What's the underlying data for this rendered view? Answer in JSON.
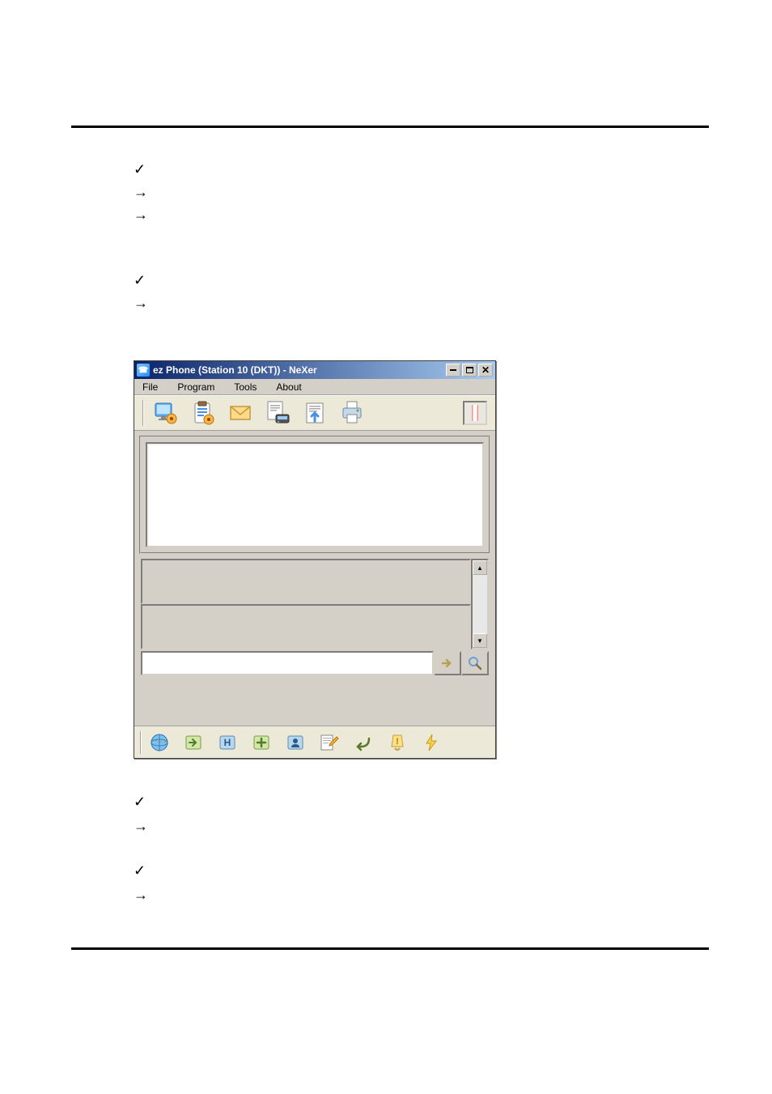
{
  "bullets": {
    "top": [
      "✓",
      "→",
      "→"
    ],
    "mid": [
      "✓",
      "→"
    ],
    "bottom1": [
      "✓",
      "→"
    ],
    "bottom2": [
      "✓",
      "→"
    ]
  },
  "window": {
    "title": "ez Phone (Station 10 (DKT)) - NeXer",
    "menus": [
      "File",
      "Program",
      "Tools",
      "About"
    ],
    "toolbar": [
      {
        "name": "monitor-settings-icon"
      },
      {
        "name": "clipboard-settings-icon"
      },
      {
        "name": "mail-icon"
      },
      {
        "name": "document-device-icon"
      },
      {
        "name": "document-up-icon"
      },
      {
        "name": "printer-icon"
      }
    ],
    "record_label": "",
    "go_label": "",
    "search_label": "",
    "bottom_icons": [
      {
        "name": "globe-icon"
      },
      {
        "name": "forward-box-icon"
      },
      {
        "name": "hold-icon"
      },
      {
        "name": "plus-box-icon"
      },
      {
        "name": "user-box-icon"
      },
      {
        "name": "edit-paper-icon"
      },
      {
        "name": "reply-arrow-icon"
      },
      {
        "name": "bell-alert-icon"
      },
      {
        "name": "lightning-icon"
      }
    ]
  }
}
